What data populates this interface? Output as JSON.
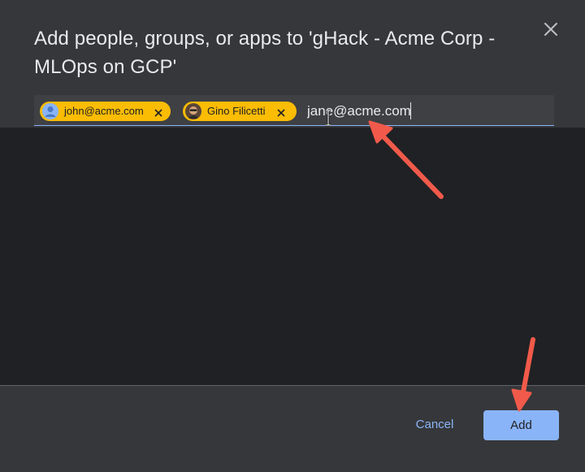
{
  "dialog": {
    "title_line1": "Add people, groups, or apps to 'gHack - Acme Corp -",
    "title_line2": "MLOps on GCP'",
    "close_icon": "close-icon"
  },
  "chips": [
    {
      "label": "john@acme.com",
      "avatar": "person-icon",
      "remove_icon": "close-icon"
    },
    {
      "label": "Gino Filicetti",
      "avatar": "profile-photo",
      "remove_icon": "close-icon"
    }
  ],
  "input": {
    "value": "jane@acme.com"
  },
  "footer": {
    "cancel_label": "Cancel",
    "add_label": "Add"
  },
  "colors": {
    "chip_bg": "#fbbc04",
    "accent": "#8ab4f8",
    "annotation_arrow": "#f15a4a",
    "panel_bg": "#36373a",
    "results_bg": "#202124"
  }
}
